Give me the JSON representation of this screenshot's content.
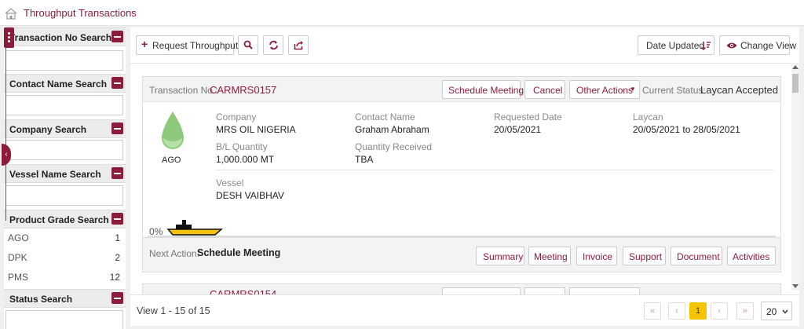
{
  "header": {
    "title": "Throughput Transactions"
  },
  "sidebar": {
    "sections": [
      {
        "label": "Transaction No Search"
      },
      {
        "label": "Contact Name Search"
      },
      {
        "label": "Company Search"
      },
      {
        "label": "Vessel Name Search"
      },
      {
        "label": "Product Grade Search"
      },
      {
        "label": "Status Search"
      }
    ],
    "product_grades": [
      {
        "name": "AGO",
        "count": "1"
      },
      {
        "name": "DPK",
        "count": "2"
      },
      {
        "name": "PMS",
        "count": "12"
      }
    ]
  },
  "toolbar": {
    "request_label": "Request Throughput",
    "date_updated_label": "Date Updated",
    "change_view_label": "Change View"
  },
  "card": {
    "txn_label": "Transaction No.:",
    "txn_no": "CARMRS0157",
    "schedule_meeting": "Schedule Meeting",
    "cancel": "Cancel",
    "other_actions": "Other Actions",
    "status_label": "Current Status:",
    "status_value": "Laycan Accepted",
    "product": "AGO",
    "company_label": "Company",
    "company_value": "MRS OIL NIGERIA",
    "contact_label": "Contact Name",
    "contact_value": "Graham Abraham",
    "requested_label": "Requested Date",
    "requested_value": "20/05/2021",
    "laycan_label": "Laycan",
    "laycan_value": "20/05/2021 to 28/05/2021",
    "bl_label": "B/L Quantity",
    "bl_value": "1,000.000 MT",
    "qty_label": "Quantity Received",
    "qty_value": "TBA",
    "vessel_label": "Vessel",
    "vessel_value": "DESH VAIBHAV",
    "progress_text": "0%",
    "progress": 0,
    "next_action_label": "Next Action:",
    "next_action_value": "Schedule Meeting",
    "footer_buttons": [
      "Summary",
      "Meeting",
      "Invoice",
      "Support",
      "Document",
      "Activities"
    ]
  },
  "second_card": {
    "txn_no_partial": "CARMRS0154"
  },
  "footer": {
    "view_text": "View 1 - 15 of 15",
    "current_page": "1",
    "page_size": "20"
  },
  "colors": {
    "accent": "#8b1c3c",
    "active_page": "#f5c400",
    "drop": "#8cc97a"
  }
}
